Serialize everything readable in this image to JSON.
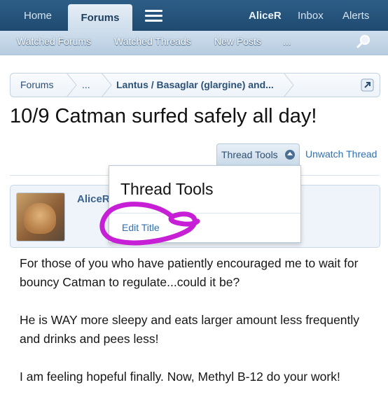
{
  "top_nav": {
    "home": "Home",
    "forums": "Forums",
    "user": "AliceR",
    "inbox": "Inbox",
    "alerts": "Alerts"
  },
  "sub_nav": {
    "watched_forums": "Watched Forums",
    "watched_threads": "Watched Threads",
    "new_posts": "New Posts",
    "more": "..."
  },
  "breadcrumb": [
    "Forums",
    "...",
    "Lantus / Basaglar (glargine) and..."
  ],
  "thread": {
    "title": "10/9 Catman surfed safely all day!",
    "tools_label": "Thread Tools",
    "unwatch_label": "Unwatch Thread"
  },
  "popup": {
    "title": "Thread Tools",
    "item": "Edit Title"
  },
  "post": {
    "author": "AliceR",
    "paragraphs": [
      "For those of you who have patiently encouraged me to wait for bouncy Catman to regulate...could it be?",
      "He is WAY more sleepy and eats larger amount less frequently and drinks and pees less!",
      "I am feeling hopeful finally. Now, Methyl B-12 do your work!"
    ]
  },
  "colors": {
    "nav_bg": "#1f4a70",
    "link": "#2f6fb3",
    "annotation": "#c61fd6"
  },
  "icons": [
    "menu-icon",
    "search-icon",
    "external-link-icon",
    "chevron-up-icon"
  ]
}
